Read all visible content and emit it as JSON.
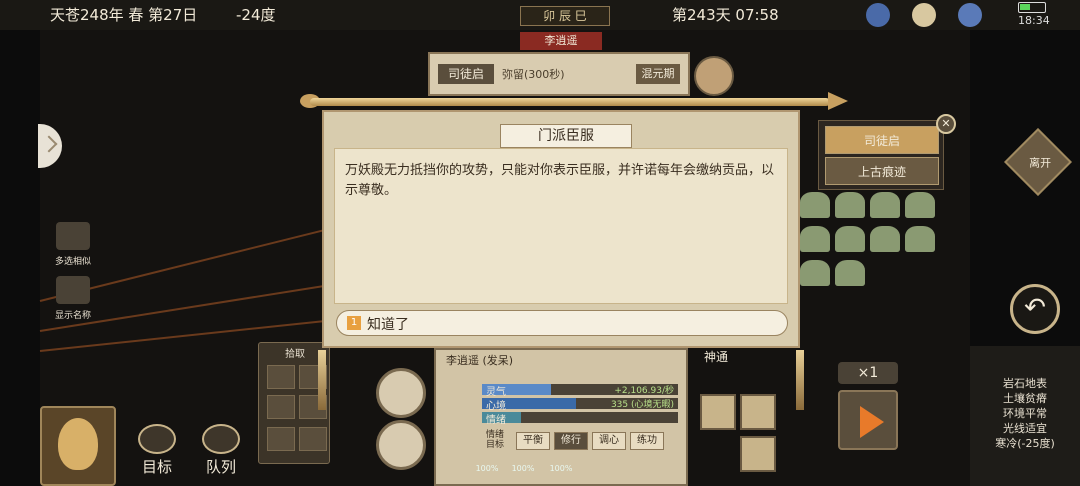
{
  "topbar": {
    "date": "天苍248年 春 第27日",
    "temperature": "-24度",
    "season_badge": "卯 辰 巳",
    "day_time": "第243天 07:58",
    "clock": "18:34"
  },
  "left_panel": {
    "multi_select": "多选相似",
    "show_names": "显示名称",
    "picker_title": "拾取",
    "goal": "目标",
    "queue": "队列"
  },
  "character_card": {
    "tab": "李逍遥",
    "name": "司徒启",
    "status": "弥留(300秒)",
    "realm": "混元期"
  },
  "status_panel": {
    "name": "李逍遥 (发呆)",
    "bars": [
      {
        "label": "灵气",
        "value": "+2,106.93/秒",
        "fill": 0.35,
        "color": "#5a8ac8"
      },
      {
        "label": "心境",
        "value": "335 (心境无暇)",
        "fill": 0.48,
        "color": "#3a6aa8"
      },
      {
        "label": "情绪",
        "value": "",
        "fill": 0.2,
        "color": "#4a8a9a"
      }
    ],
    "emotion_label": "情绪目标",
    "emotion_buttons": [
      "平衡",
      "修行",
      "调心",
      "练功"
    ],
    "active_emotion": 1,
    "percents": [
      "100%",
      "100%",
      "100%"
    ]
  },
  "dialog": {
    "title": "门派臣服",
    "body": "万妖殿无力抵挡你的攻势，只能对你表示臣服，并许诺每年会缴纳贡品，以示尊敬。",
    "choice_num": "1",
    "choice_label": "知道了"
  },
  "right_menu": {
    "items": [
      "司徒启",
      "上古痕迹"
    ],
    "leave": "离开",
    "shentong": "神通",
    "speed": "×1"
  },
  "environment": [
    "岩石地表",
    "土壤贫瘠",
    "环境平常",
    "光线适宜",
    "寒冷(-25度)"
  ]
}
